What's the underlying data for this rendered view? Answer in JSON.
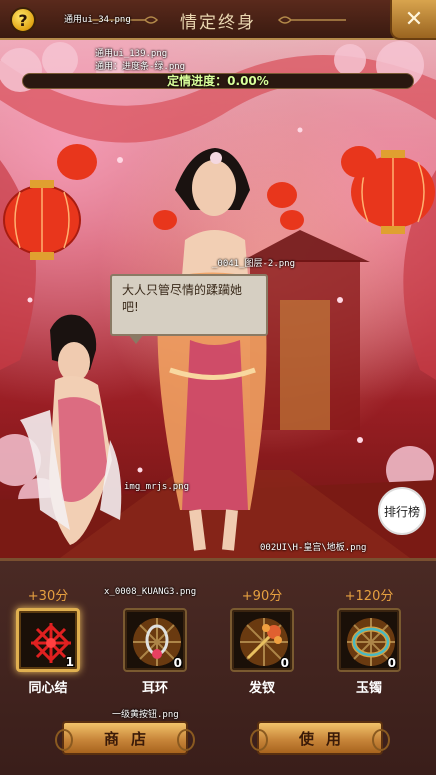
{
  "header": {
    "title": "情定终身",
    "help_symbol": "?",
    "close_symbol": "✕"
  },
  "debug_labels": {
    "help": "通用ui_34.png",
    "ui139": "通用ui_139.png",
    "progress_bar": "通用：进度条-绿.png",
    "bubble": "_0041_图层-2.png",
    "girl": "img_mrjs.png",
    "floor": "002UI\\H-皇宫\\地板.png",
    "frame": "x_0008_KUANG3.png",
    "button": "一级黄按钮.png"
  },
  "progress": {
    "label": "定情进度：0.00%",
    "value_percent": 0,
    "color": "#9ad24a"
  },
  "bubble_text": "大人只管尽情的蹂躏她吧!",
  "rank_button": "排行榜",
  "items": [
    {
      "name": "同心结",
      "score": "+30分",
      "count": "1",
      "icon": "red-knot-icon",
      "selected": true
    },
    {
      "name": "耳环",
      "score": "",
      "count": "0",
      "icon": "earring-icon",
      "selected": false
    },
    {
      "name": "发钗",
      "score": "+90分",
      "count": "0",
      "icon": "hairpin-icon",
      "selected": false
    },
    {
      "name": "玉镯",
      "score": "+120分",
      "count": "0",
      "icon": "jade-bracelet-icon",
      "selected": false
    }
  ],
  "buttons": {
    "shop": "商店",
    "use": "使用"
  }
}
